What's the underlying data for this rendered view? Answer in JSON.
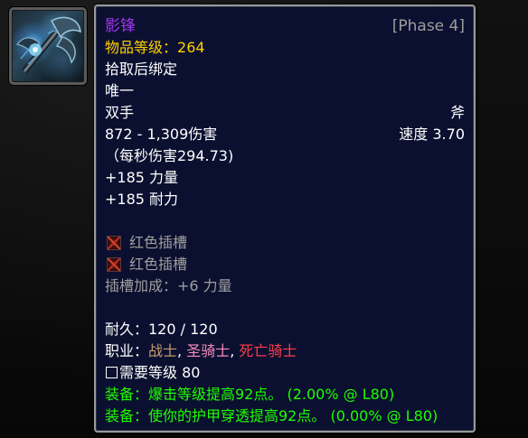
{
  "colors": {
    "epic": "#a335ee",
    "item_level": "#ffd100",
    "phase": "#9d9d9d",
    "green": "#1eff00",
    "warrior": "#c79c6e",
    "paladin": "#f58cba",
    "death_knight": "#ff3b4a",
    "tooltip_bg": "#0b1030"
  },
  "icon": {
    "name": "two-handed-axe-icon"
  },
  "tooltip": {
    "name": "影锋",
    "phase": "[Phase 4]",
    "item_level_label": "物品等级：",
    "item_level": "264",
    "bind": "拾取后绑定",
    "unique": "唯一",
    "slot": "双手",
    "weapon_type": "斧",
    "damage": "872 - 1,309伤害",
    "speed": "速度 3.70",
    "dps": "（每秒伤害294.73)",
    "stats": [
      "+185 力量",
      "+185 耐力"
    ],
    "sockets": [
      {
        "icon": "red-socket-icon",
        "label": "红色插槽"
      },
      {
        "icon": "red-socket-icon",
        "label": "红色插槽"
      }
    ],
    "socket_bonus": "插槽加成：+6 力量",
    "durability": "耐久：120 / 120",
    "classes_label": "职业：",
    "classes": [
      "战士",
      "圣骑士",
      "死亡骑士"
    ],
    "separator": ", ",
    "required_level": "需要等级 80",
    "equip_effects": [
      "装备：爆击等级提高92点。 (2.00% @ L80)",
      "装备：使你的护甲穿透提高92点。 (0.00% @ L80)"
    ]
  }
}
